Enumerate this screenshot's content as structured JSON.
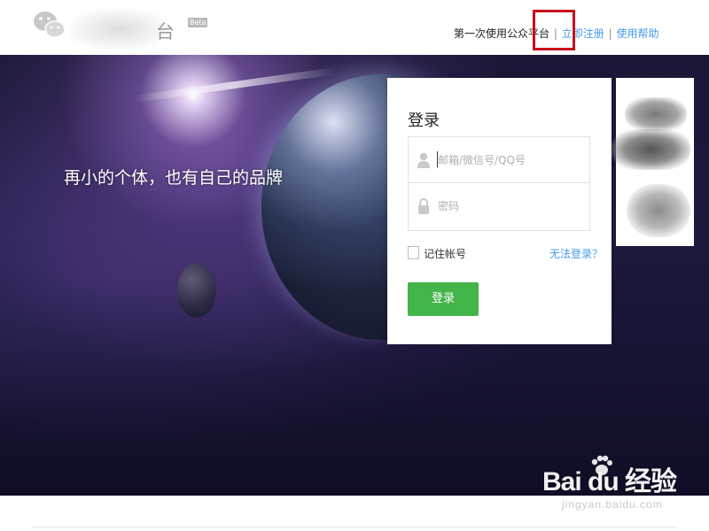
{
  "header": {
    "logo_name": "台",
    "beta": "Beta",
    "nav": {
      "intro": "第一次使用公众平台",
      "separator": "|",
      "register": "立即注册",
      "help": "使用帮助"
    }
  },
  "banner": {
    "slogan": "再小的个体，也有自己的品牌"
  },
  "login": {
    "title": "登录",
    "username_placeholder": "邮箱/微信号/QQ号",
    "password_placeholder": "密码",
    "remember_label": "记住帐号",
    "forgot_link": "无法登录？",
    "submit_label": "登录"
  },
  "watermark": {
    "brand": "Bai du 经验",
    "url": "jingyan.baidu.com"
  },
  "colors": {
    "accent_green": "#44b549",
    "link_blue": "#459ae9",
    "highlight_red": "#c7111b"
  }
}
